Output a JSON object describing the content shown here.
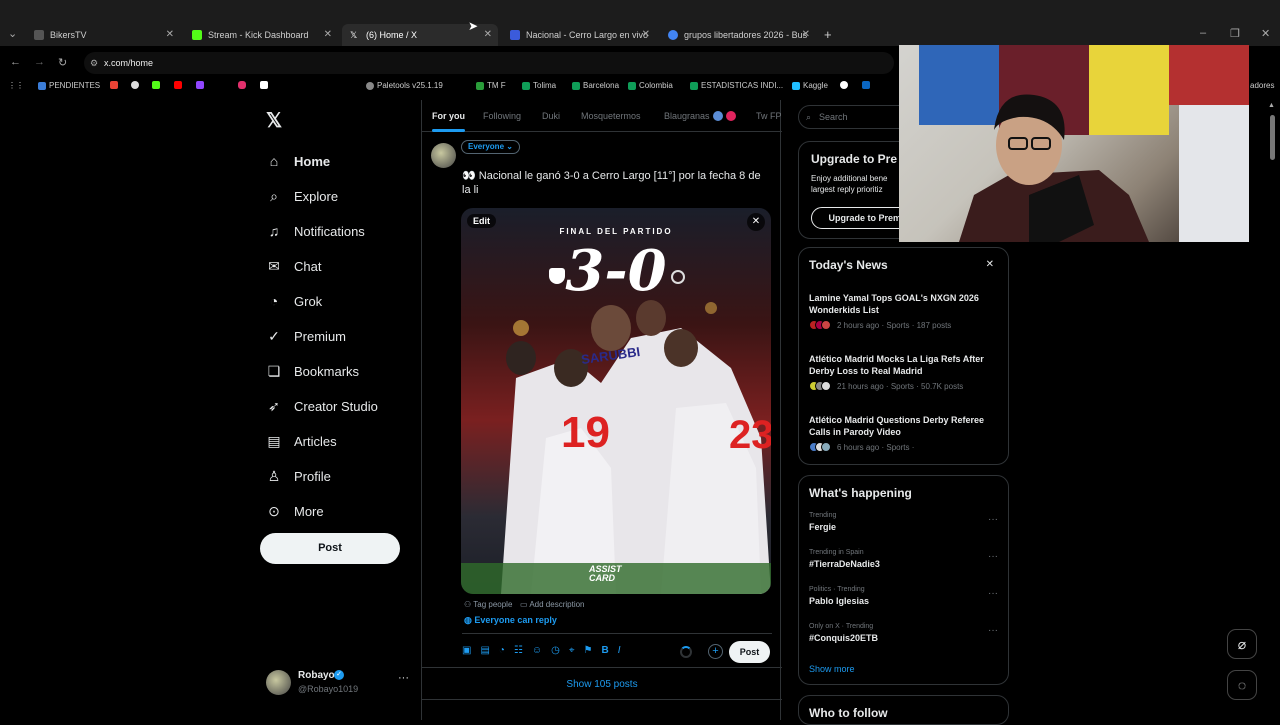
{
  "browser": {
    "tabs": [
      {
        "title": "BikersTV",
        "color": "#555555"
      },
      {
        "title": "Stream - Kick Dashboard",
        "color": "#53fc18"
      },
      {
        "title": "(6) Home / X",
        "color": "#ffffff"
      },
      {
        "title": "Nacional - Cerro Largo en vivo",
        "color": "#3b5bdb"
      },
      {
        "title": "grupos libertadores 2026 - Bus",
        "color": "#4285f4"
      }
    ],
    "url": "x.com/home",
    "bookmarks": [
      "PENDIENTES",
      "Paletools v25.1.19",
      "TM F",
      "Tolima",
      "Barcelona",
      "Colombia",
      "ESTADISTICAS INDI...",
      "Kaggle",
      "adores"
    ]
  },
  "nav": {
    "items": [
      {
        "label": "Home",
        "icon": "home-icon"
      },
      {
        "label": "Explore",
        "icon": "search-icon"
      },
      {
        "label": "Notifications",
        "icon": "bell-icon"
      },
      {
        "label": "Chat",
        "icon": "mail-icon"
      },
      {
        "label": "Grok",
        "icon": "grok-icon"
      },
      {
        "label": "Premium",
        "icon": "verified-icon"
      },
      {
        "label": "Bookmarks",
        "icon": "bookmark-icon"
      },
      {
        "label": "Creator Studio",
        "icon": "rocket-icon"
      },
      {
        "label": "Articles",
        "icon": "article-icon"
      },
      {
        "label": "Profile",
        "icon": "person-icon"
      },
      {
        "label": "More",
        "icon": "more-circle-icon"
      }
    ],
    "post_label": "Post"
  },
  "user": {
    "name": "Robayo",
    "handle": "@Robayo1019"
  },
  "feed": {
    "tabs": [
      "For you",
      "Following",
      "Duki",
      "Mosquetermos",
      "Blaugranas",
      "Tw FP"
    ],
    "audience": "Everyone",
    "composer_text": "👀 Nacional le ganó 3-0 a Cerro Largo [11°] por la fecha 8 de la li",
    "media": {
      "edit_label": "Edit",
      "header": "FINAL DEL PARTIDO",
      "score": "3-0",
      "sponsor": "ASSIST CARD",
      "jersey_numbers": [
        "19",
        "23"
      ],
      "jersey_sponsor": "SARUBBI"
    },
    "tag_people": "Tag people",
    "add_description": "Add description",
    "reply_setting": "Everyone can reply",
    "post_label": "Post",
    "show_posts": "Show 105 posts"
  },
  "right": {
    "search_placeholder": "Search",
    "premium": {
      "title": "Upgrade to Pre",
      "text": "Enjoy additional bene largest reply prioritiz",
      "button": "Upgrade to Premi"
    },
    "news_title": "Today's News",
    "news": [
      {
        "title": "Lamine Yamal Tops GOAL's NXGN 2026 Wonderkids List",
        "meta": "2 hours ago · Sports · 187 posts"
      },
      {
        "title": "Atlético Madrid Mocks La Liga Refs After Derby Loss to Real Madrid",
        "meta": "21 hours ago · Sports · 50.7K posts"
      },
      {
        "title": "Atlético Madrid Questions Derby Referee Calls in Parody Video",
        "meta": "6 hours ago · Sports ·"
      }
    ],
    "happening_title": "What's happening",
    "trends": [
      {
        "context": "Trending",
        "name": "Fergie"
      },
      {
        "context": "Trending in Spain",
        "name": "#TierraDeNadie3"
      },
      {
        "context": "Politics · Trending",
        "name": "Pablo Iglesias"
      },
      {
        "context": "Only on X · Trending",
        "name": "#Conquis20ETB"
      }
    ],
    "show_more": "Show more",
    "who_to_follow": "Who to follow"
  }
}
